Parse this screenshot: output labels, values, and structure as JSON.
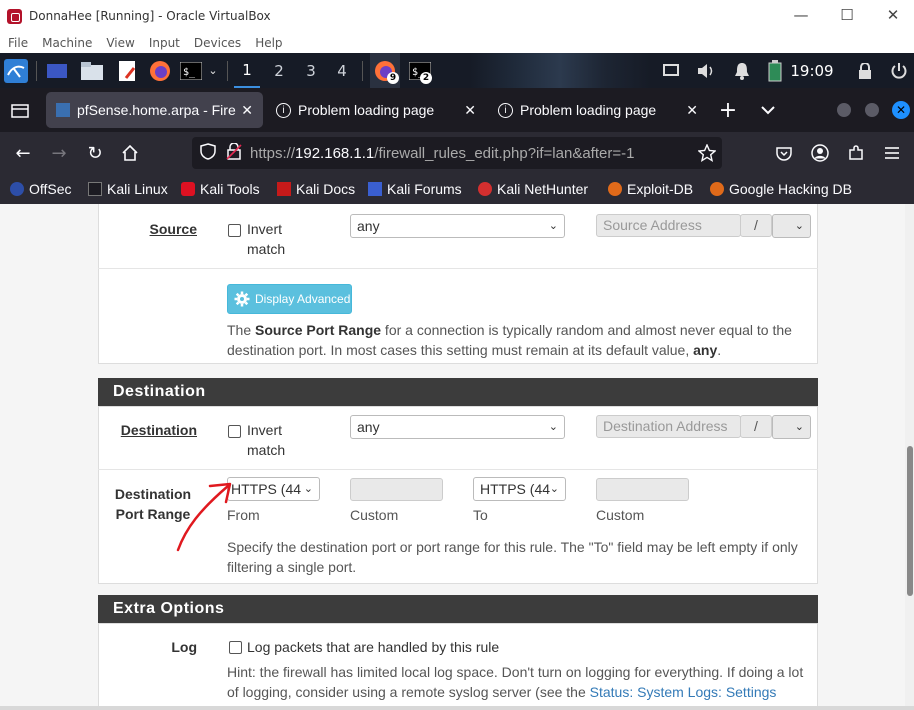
{
  "window": {
    "title": "DonnaHee [Running] - Oracle VirtualBox",
    "menu": [
      "File",
      "Machine",
      "View",
      "Input",
      "Devices",
      "Help"
    ]
  },
  "taskbar": {
    "workspaces": [
      "1",
      "2",
      "3",
      "4"
    ],
    "firefox_badge": "9",
    "terminal_badge": "2",
    "clock": "19:09"
  },
  "browser": {
    "tabs": [
      {
        "label": "pfSense.home.arpa - Fire"
      },
      {
        "label": "Problem loading page"
      },
      {
        "label": "Problem loading page"
      }
    ],
    "url": {
      "scheme": "https://",
      "host": "192.168.1.1",
      "path": "/firewall_rules_edit.php?if=lan&after=-1"
    },
    "bookmarks": [
      "OffSec",
      "Kali Linux",
      "Kali Tools",
      "Kali Docs",
      "Kali Forums",
      "Kali NetHunter",
      "Exploit-DB",
      "Google Hacking DB"
    ]
  },
  "page": {
    "source": {
      "label": "Source",
      "invert_line1": "Invert",
      "invert_line2": "match",
      "select_value": "any",
      "address_placeholder": "Source Address",
      "slash": "/"
    },
    "advanced": {
      "button_label": "Display Advanced",
      "help_prefix": "The ",
      "help_bold": "Source Port Range",
      "help_mid": " for a connection is typically random and almost never equal to the destination port. In most cases this setting must remain at its default value, ",
      "help_bold2": "any",
      "help_suffix": "."
    },
    "destination_section": {
      "heading": "Destination",
      "label": "Destination",
      "invert_line1": "Invert",
      "invert_line2": "match",
      "select_value": "any",
      "address_placeholder": "Destination Address",
      "slash": "/"
    },
    "port_range": {
      "label_line1": "Destination",
      "label_line2": "Port Range",
      "from_value": "HTTPS (44",
      "from_caption": "From",
      "custom1_caption": "Custom",
      "to_value": "HTTPS (44",
      "to_caption": "To",
      "custom2_caption": "Custom",
      "help": "Specify the destination port or port range for this rule. The \"To\" field may be left empty if only filtering a single port."
    },
    "extra": {
      "heading": "Extra Options",
      "log_label": "Log",
      "log_checkbox_text": "Log packets that are handled by this rule",
      "hint_text": "Hint: the firewall has limited local log space. Don't turn on logging for everything. If doing a lot of logging, consider using a remote syslog server (see the ",
      "hint_link": "Status: System Logs: Settings"
    }
  },
  "colors": {
    "annotation": "#e0191f",
    "panel_heading": "#3c3c3c",
    "info_button": "#5bc0de",
    "link": "#337ab7"
  }
}
